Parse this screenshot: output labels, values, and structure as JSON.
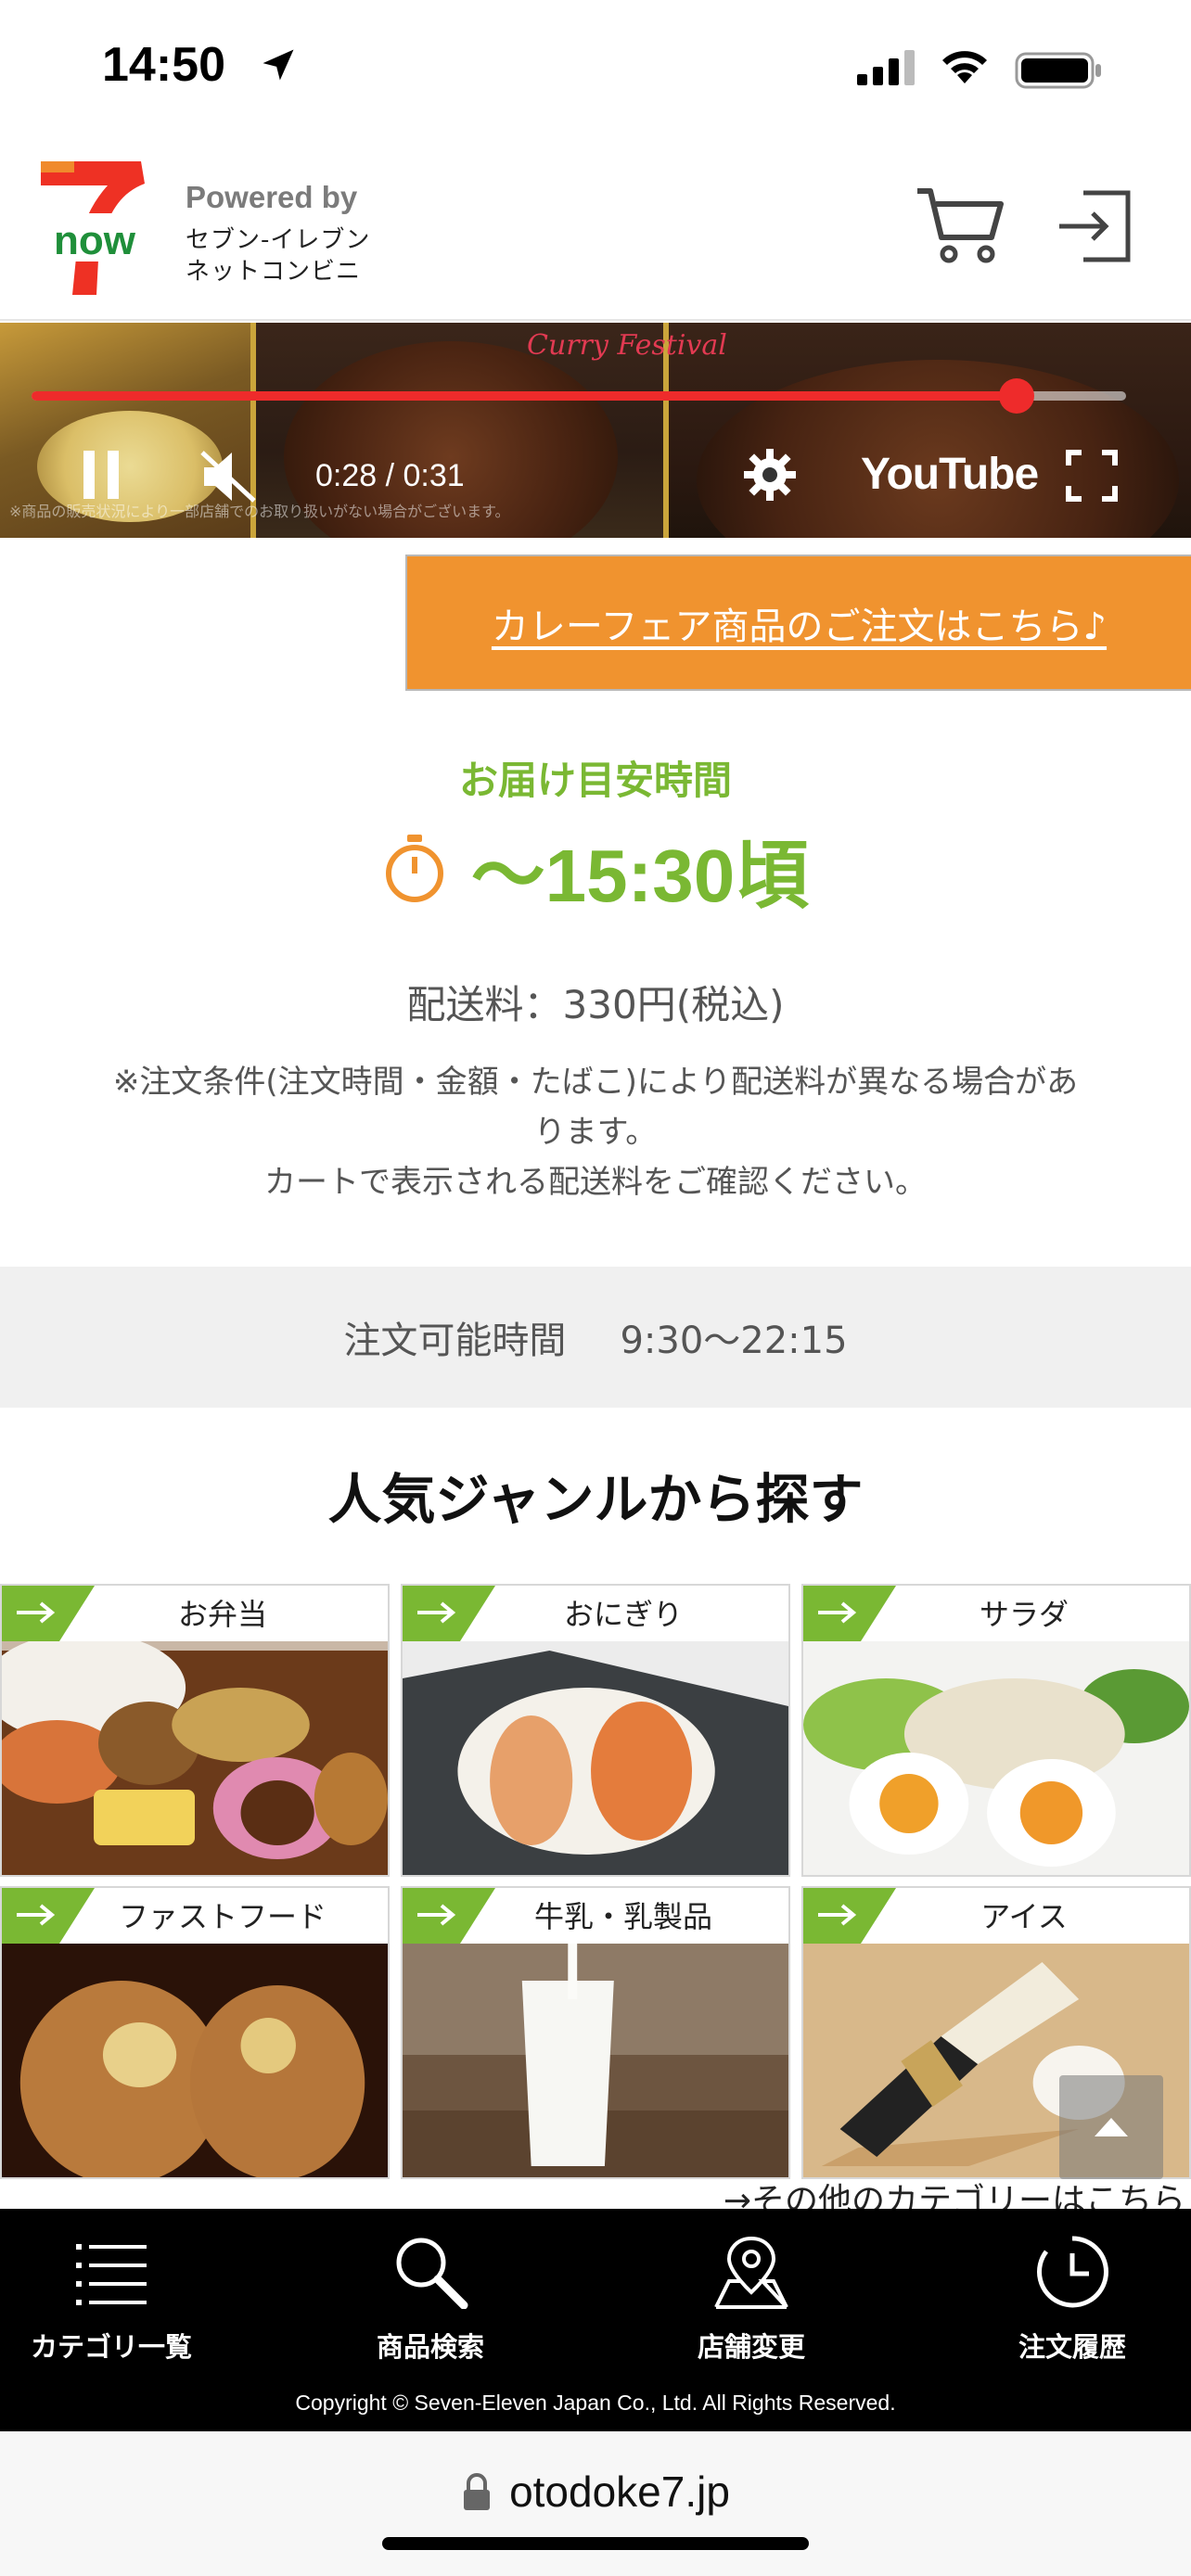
{
  "status_bar": {
    "time": "14:50"
  },
  "header": {
    "logo_text": "now",
    "powered_by": "Powered by",
    "brand_line1": "セブン-イレブン",
    "brand_line2": "ネットコンビニ"
  },
  "video": {
    "time": "0:28 / 0:31",
    "progress": 0.9,
    "overlay_text": "Curry Festival",
    "platform": "YouTube",
    "muted": true,
    "caption": "※商品の販売状況により一部店舗でのお取り扱いがない場合がございます。"
  },
  "promo_button": {
    "label": "カレーフェア商品のご注文はこちら♪"
  },
  "delivery": {
    "label": "お届け目安時間",
    "time": "〜15:30頃",
    "fee": "配送料：330円(税込)",
    "note_line1": "※注文条件(注文時間・金額・たばこ)により配送料が異なる場合があ",
    "note_line2": "ります。",
    "note_line3": "カートで表示される配送料をご確認ください。"
  },
  "order_hours": {
    "label": "注文可能時間",
    "value": "9:30〜22:15"
  },
  "genres": {
    "title": "人気ジャンルから探す",
    "items": [
      {
        "label": "お弁当"
      },
      {
        "label": "おにぎり"
      },
      {
        "label": "サラダ"
      },
      {
        "label": "ファストフード"
      },
      {
        "label": "牛乳・乳製品"
      },
      {
        "label": "アイス"
      }
    ],
    "more_link": "→その他のカテゴリーはこちら"
  },
  "bottom_nav": {
    "items": [
      {
        "label": "カテゴリ一覧",
        "icon": "list-icon"
      },
      {
        "label": "商品検索",
        "icon": "search-icon"
      },
      {
        "label": "店舗変更",
        "icon": "map-pin-icon"
      },
      {
        "label": "注文履歴",
        "icon": "clock-icon"
      }
    ],
    "copyright": "Copyright © Seven-Eleven Japan Co., Ltd. All Rights Reserved."
  },
  "browser": {
    "url": "otodoke7.jp"
  },
  "colors": {
    "brand_green": "#7ab833",
    "orange": "#f0932f",
    "progress_red": "#ee2b2b"
  }
}
